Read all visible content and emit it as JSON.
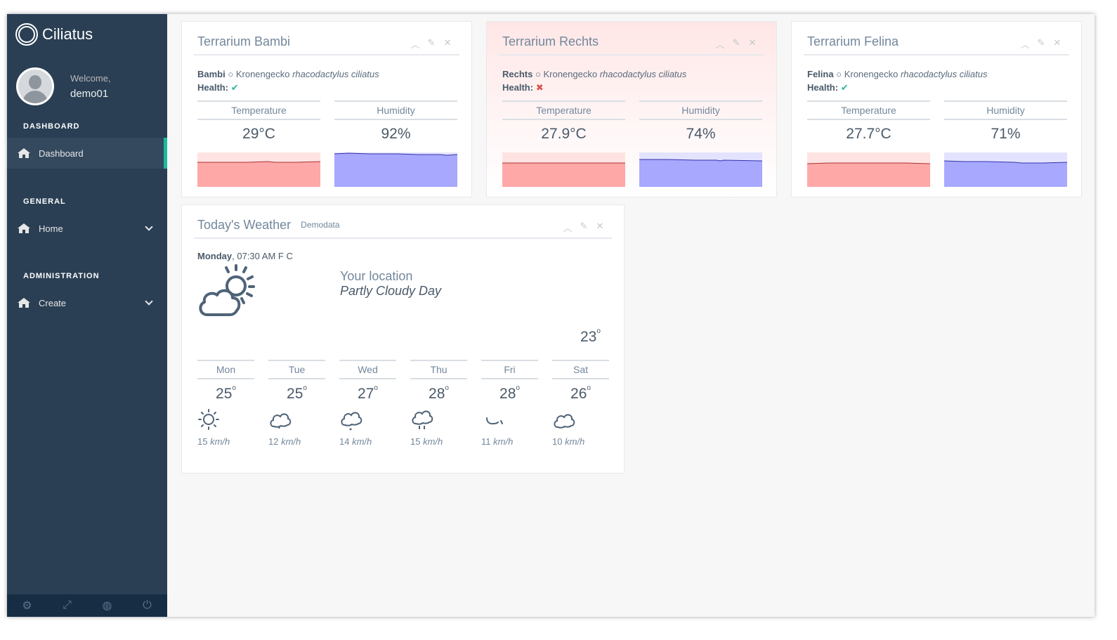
{
  "brand": {
    "name": "Ciliatus"
  },
  "profile": {
    "welcome": "Welcome,",
    "username": "demo01"
  },
  "sidebar": {
    "sections": [
      {
        "title": "DASHBOARD",
        "item": "Dashboard"
      },
      {
        "title": "GENERAL",
        "item": "Home"
      },
      {
        "title": "ADMINISTRATION",
        "item": "Create"
      }
    ],
    "footer_icons": [
      "settings-icon",
      "fullscreen-icon",
      "eye-slash-icon",
      "power-icon"
    ]
  },
  "terrariums": [
    {
      "title": "Terrarium Bambi",
      "animal": "Bambi",
      "species_common": "Kronengecko",
      "species_latin": "rhacodactylus ciliatus",
      "health_label": "Health:",
      "healthy": true,
      "health_mark": "✔",
      "temp_label": "Temperature",
      "temp": "29°C",
      "hum_label": "Humidity",
      "hum": "92%",
      "temp_level": 0.7,
      "hum_level": 0.95
    },
    {
      "title": "Terrarium Rechts",
      "animal": "Rechts",
      "species_common": "Kronengecko",
      "species_latin": "rhacodactylus ciliatus",
      "health_label": "Health:",
      "healthy": false,
      "health_mark": "✖",
      "temp_label": "Temperature",
      "temp": "27.9°C",
      "hum_label": "Humidity",
      "hum": "74%",
      "temp_level": 0.68,
      "hum_level": 0.77
    },
    {
      "title": "Terrarium Felina",
      "animal": "Felina",
      "species_common": "Kronengecko",
      "species_latin": "rhacodactylus ciliatus",
      "health_label": "Health:",
      "healthy": true,
      "health_mark": "✔",
      "temp_label": "Temperature",
      "temp": "27.7°C",
      "hum_label": "Humidity",
      "hum": "71%",
      "temp_level": 0.68,
      "hum_level": 0.72
    }
  ],
  "weather": {
    "title": "Today's Weather",
    "subtitle": "Demodata",
    "day": "Monday",
    "time": ", 07:30 AM F C",
    "location": "Your location",
    "condition": "Partly Cloudy Day",
    "current_temp": "23",
    "forecast": [
      {
        "day": "Mon",
        "temp": "25",
        "icon": "sun-icon",
        "wind_value": "15",
        "wind_unit": "km/h"
      },
      {
        "day": "Tue",
        "temp": "25",
        "icon": "cloud-icon",
        "wind_value": "12",
        "wind_unit": "km/h"
      },
      {
        "day": "Wed",
        "temp": "27",
        "icon": "cloud-drizzle-icon",
        "wind_value": "14",
        "wind_unit": "km/h"
      },
      {
        "day": "Thu",
        "temp": "28",
        "icon": "cloud-rain-icon",
        "wind_value": "15",
        "wind_unit": "km/h"
      },
      {
        "day": "Fri",
        "temp": "28",
        "icon": "moon-icon",
        "wind_value": "11",
        "wind_unit": "km/h"
      },
      {
        "day": "Sat",
        "temp": "26",
        "icon": "cloud-icon",
        "wind_value": "10",
        "wind_unit": "km/h"
      }
    ]
  },
  "colors": {
    "sidebar": "#2a3f54",
    "accent": "#1abb9c",
    "temp_fill": "#ffa8a8",
    "hum_fill": "#a8a8ff",
    "ok": "#26b99a",
    "bad": "#d9534f"
  }
}
